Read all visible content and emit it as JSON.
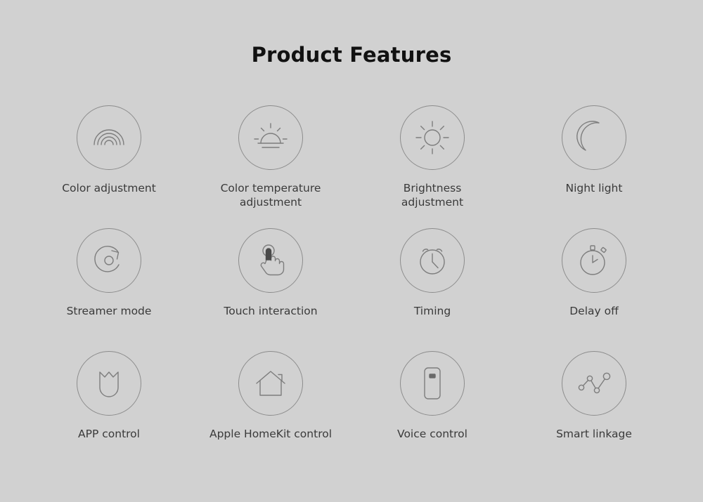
{
  "page": {
    "title": "Product Features",
    "background_color": "#d1d1d1",
    "icon_stroke_color": "#7d7d7d",
    "circle_stroke_color": "#8c8c8c",
    "title_color": "#111111",
    "label_color": "#3a3a3a"
  },
  "features": [
    {
      "id": "color-adjustment",
      "label": "Color adjustment",
      "icon": "rainbow-icon"
    },
    {
      "id": "color-temperature",
      "label": "Color temperature\nadjustment",
      "icon": "sunrise-icon"
    },
    {
      "id": "brightness",
      "label": "Brightness\nadjustment",
      "icon": "sun-icon"
    },
    {
      "id": "night-light",
      "label": "Night light",
      "icon": "moon-icon"
    },
    {
      "id": "streamer-mode",
      "label": "Streamer mode",
      "icon": "rotate-arrow-icon"
    },
    {
      "id": "touch-interaction",
      "label": "Touch interaction",
      "icon": "touch-hand-icon"
    },
    {
      "id": "timing",
      "label": "Timing",
      "icon": "alarm-clock-icon"
    },
    {
      "id": "delay-off",
      "label": "Delay off",
      "icon": "stopwatch-icon"
    },
    {
      "id": "app-control",
      "label": "APP control",
      "icon": "mi-home-app-icon"
    },
    {
      "id": "apple-homekit-control",
      "label": "Apple HomeKit control",
      "icon": "house-icon"
    },
    {
      "id": "voice-control",
      "label": "Voice control",
      "icon": "smart-speaker-icon"
    },
    {
      "id": "smart-linkage",
      "label": "Smart linkage",
      "icon": "node-graph-icon"
    }
  ]
}
